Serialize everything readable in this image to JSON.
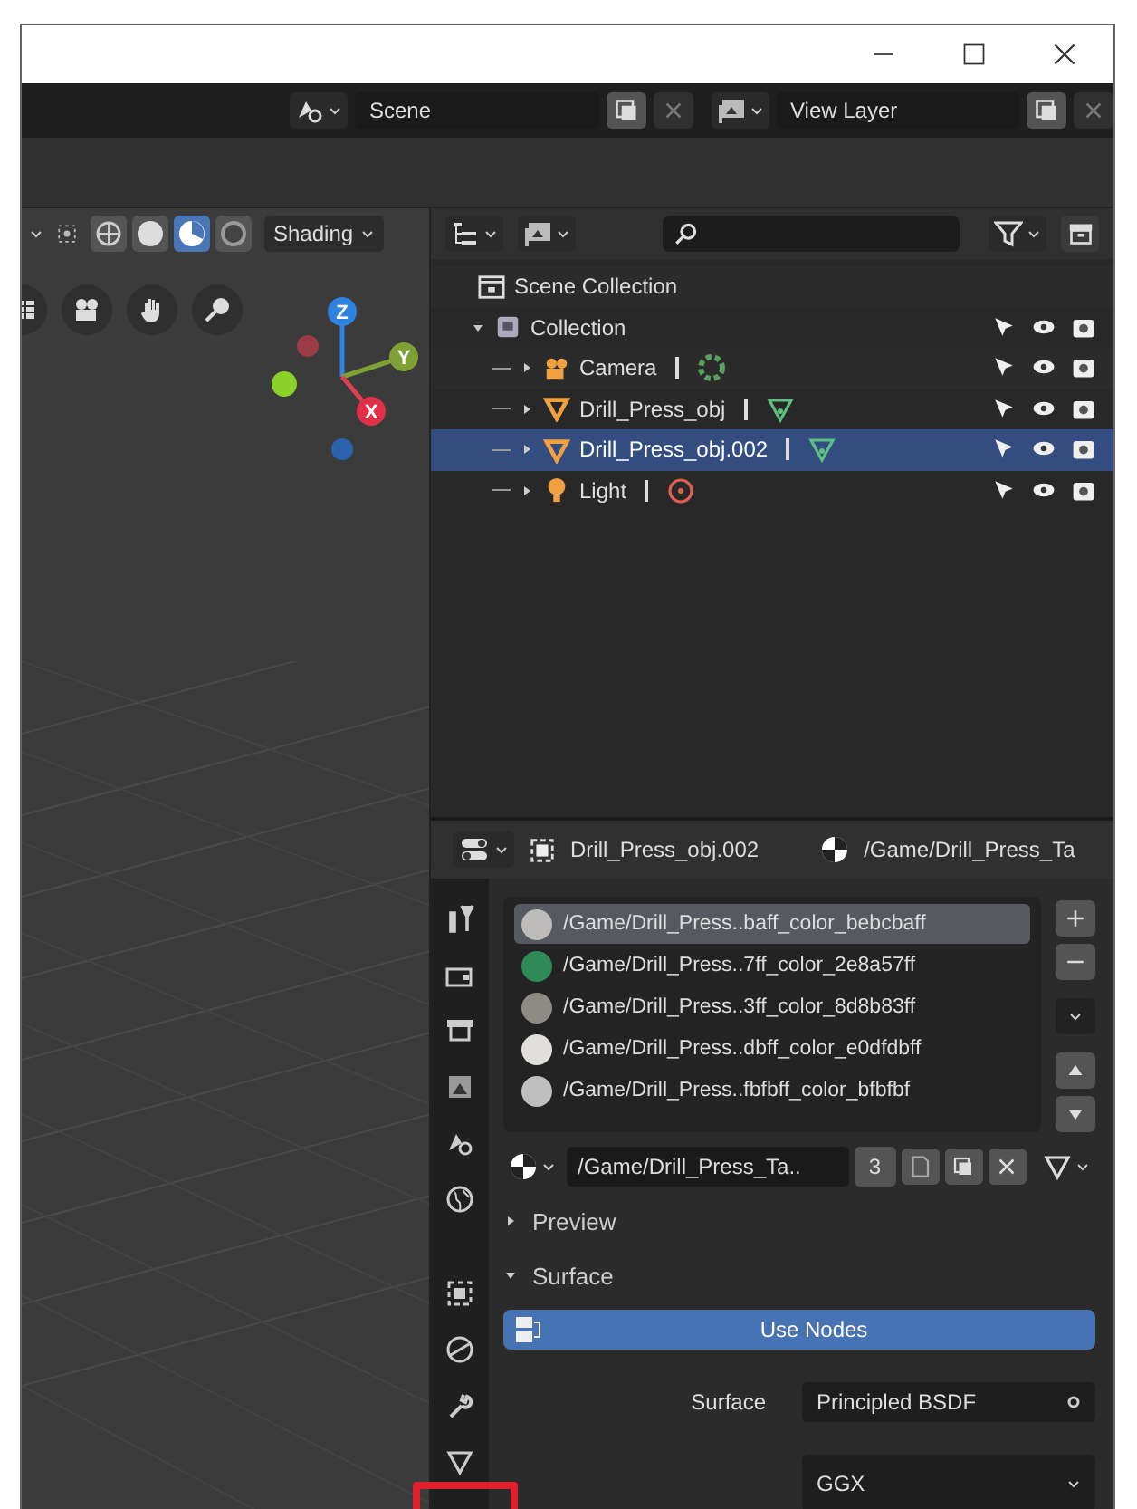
{
  "topbar": {
    "scene": "Scene",
    "view_layer": "View Layer"
  },
  "viewport": {
    "shading_label": "Shading",
    "shading_modes": [
      {
        "kind": "wireframe",
        "selected": false
      },
      {
        "kind": "solid",
        "selected": false
      },
      {
        "kind": "material",
        "selected": true
      },
      {
        "kind": "rendered",
        "selected": false
      }
    ],
    "gizmo_axes": [
      "Z",
      "Y",
      "X"
    ]
  },
  "outliner": {
    "root": {
      "label": "Scene Collection",
      "children": [
        {
          "label": "Collection",
          "kind": "collection",
          "expanded": true,
          "selected": false,
          "children": [
            {
              "label": "Camera",
              "kind": "camera",
              "expanded": false,
              "selected": false
            },
            {
              "label": "Drill_Press_obj",
              "kind": "mesh",
              "expanded": false,
              "selected": false
            },
            {
              "label": "Drill_Press_obj.002",
              "kind": "mesh",
              "expanded": false,
              "selected": true
            },
            {
              "label": "Light",
              "kind": "light",
              "expanded": false,
              "selected": false
            }
          ]
        }
      ]
    }
  },
  "properties": {
    "object_name": "Drill_Press_obj.002",
    "material_name": "/Game/Drill_Press_Ta",
    "slots": [
      {
        "label": "/Game/Drill_Press..baff_color_bebcbaff",
        "color": "#bebcba",
        "selected": true
      },
      {
        "label": "/Game/Drill_Press..7ff_color_2e8a57ff",
        "color": "#2e8a57",
        "selected": false
      },
      {
        "label": "/Game/Drill_Press..3ff_color_8d8b83ff",
        "color": "#8d8b83",
        "selected": false
      },
      {
        "label": "/Game/Drill_Press..dbff_color_e0dfdbff",
        "color": "#e0dfdb",
        "selected": false
      },
      {
        "label": "/Game/Drill_Press..fbfbff_color_bfbfbf",
        "color": "#bfbfbf",
        "selected": false
      }
    ],
    "material_field": "/Game/Drill_Press_Ta..",
    "users": "3",
    "panels": [
      {
        "label": "Preview",
        "expanded": false
      },
      {
        "label": "Surface",
        "expanded": true
      }
    ],
    "use_nodes": "Use Nodes",
    "surface_label": "Surface",
    "surface_value": "Principled BSDF",
    "distribution": "GGX"
  }
}
